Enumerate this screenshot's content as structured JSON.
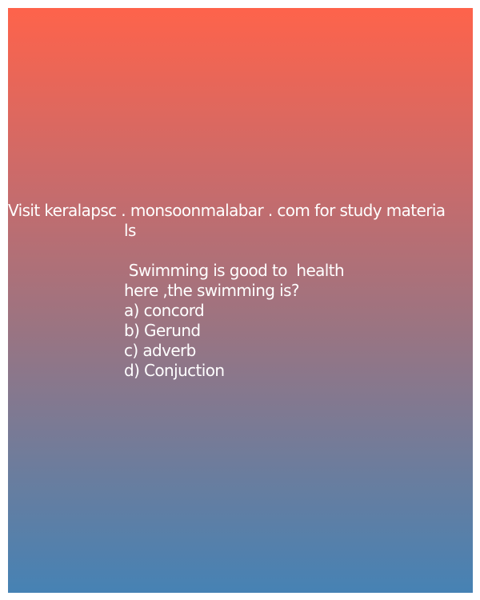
{
  "promo": {
    "line1": "Visit keralapsc . monsoonmalabar . com for study materia",
    "line2": "ls"
  },
  "question": {
    "line1": " Swimming is good to  health",
    "line2": "here ,the swimming is?"
  },
  "options": [
    "a) concord",
    "b) Gerund",
    "c) adverb",
    "d) Conjuction"
  ]
}
